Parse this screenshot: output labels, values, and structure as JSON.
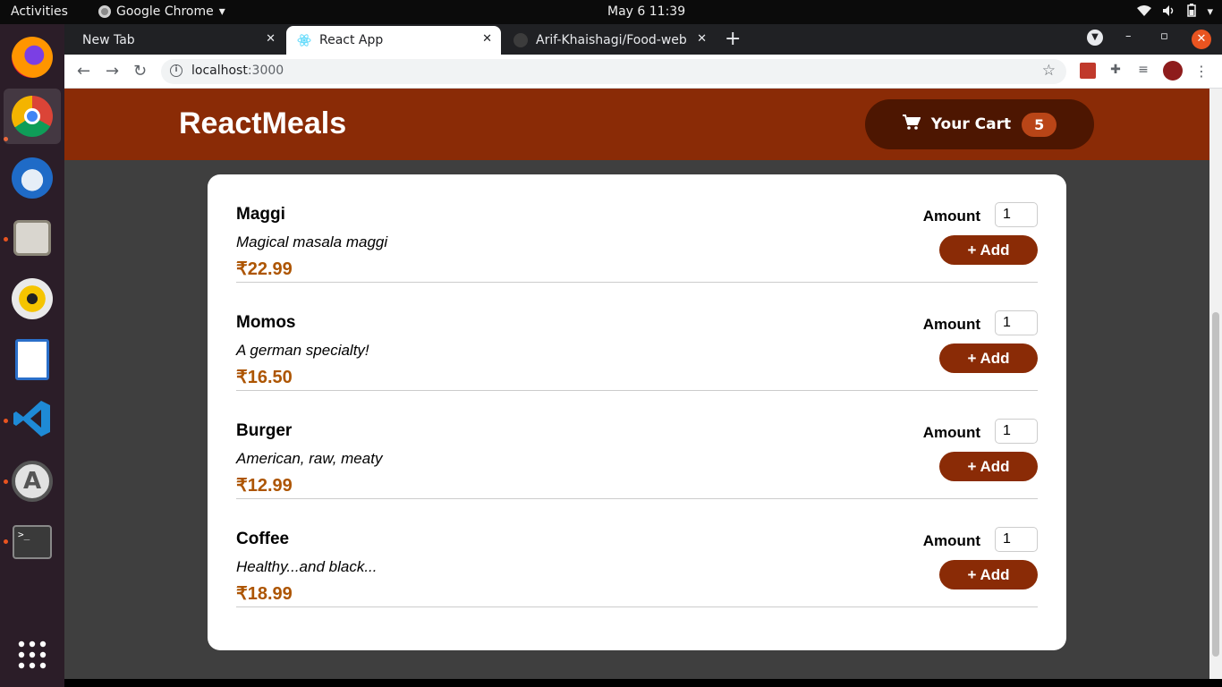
{
  "topbar": {
    "activities": "Activities",
    "app_name": "Google Chrome",
    "clock": "May 6  11:39"
  },
  "dock": {
    "items": [
      {
        "icon": "firefox-icon"
      },
      {
        "icon": "chrome-icon"
      },
      {
        "icon": "thunderbird-icon"
      },
      {
        "icon": "files-icon"
      },
      {
        "icon": "rhythmbox-icon"
      },
      {
        "icon": "writer-icon"
      },
      {
        "icon": "vscode-icon"
      },
      {
        "icon": "software-icon"
      },
      {
        "icon": "terminal-icon"
      },
      {
        "icon": "app-grid-icon"
      }
    ]
  },
  "browser": {
    "tabs": [
      {
        "label": "New Tab"
      },
      {
        "label": "React App"
      },
      {
        "label": "Arif-Khaishagi/Food-web"
      }
    ],
    "url_host": "localhost",
    "url_port": ":3000"
  },
  "app": {
    "brand": "ReactMeals",
    "cart_label": "Your Cart",
    "cart_count": "5",
    "amount_label": "Amount",
    "add_label": "+ Add",
    "meals": [
      {
        "name": "Maggi",
        "description": "Magical masala maggi",
        "price": "₹22.99",
        "amount": "1"
      },
      {
        "name": "Momos",
        "description": "A german specialty!",
        "price": "₹16.50",
        "amount": "1"
      },
      {
        "name": "Burger",
        "description": "American, raw, meaty",
        "price": "₹12.99",
        "amount": "1"
      },
      {
        "name": "Coffee",
        "description": "Healthy...and black...",
        "price": "₹18.99",
        "amount": "1"
      }
    ]
  },
  "colors": {
    "header": "#8a2b06",
    "cart_button": "#4d1601",
    "badge": "#b94517",
    "price": "#ad5502"
  }
}
